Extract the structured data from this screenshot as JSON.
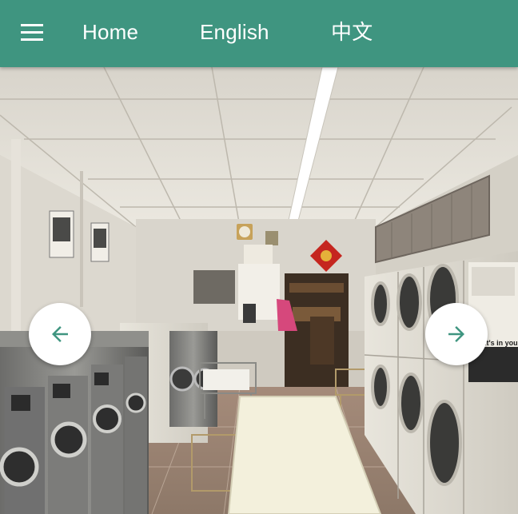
{
  "header": {
    "nav": [
      {
        "label": "Home"
      },
      {
        "label": "English"
      },
      {
        "label": "中文"
      }
    ],
    "background_color": "#3f9580"
  },
  "icons": {
    "menu": "menu-icon",
    "prev": "arrow-left-icon",
    "next": "arrow-right-icon"
  },
  "carousel": {
    "accent_color": "#3f9580",
    "poster_text": "It's in your ash"
  }
}
